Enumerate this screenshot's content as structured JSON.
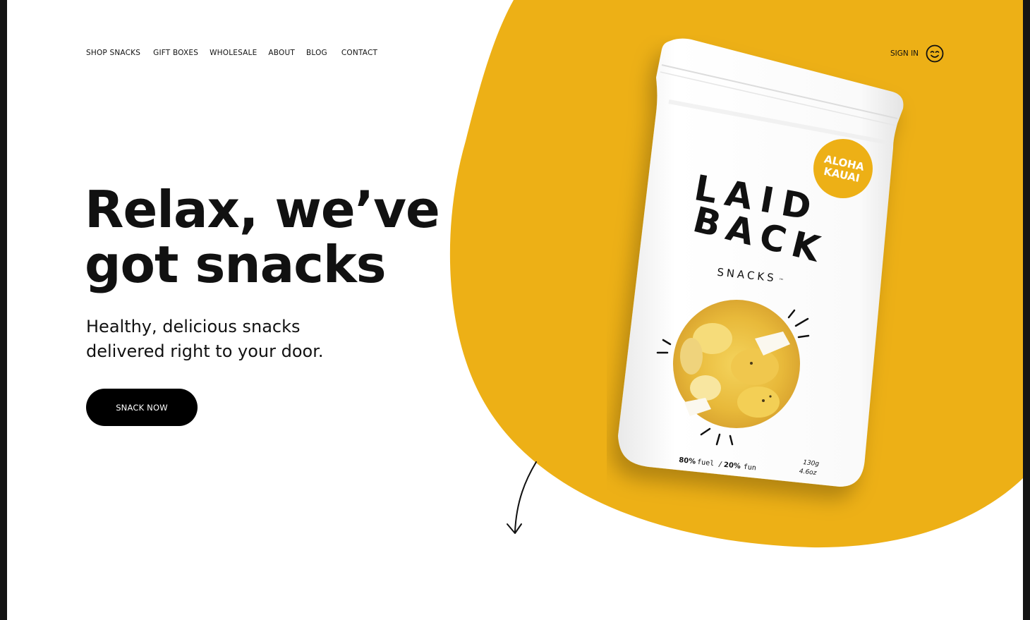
{
  "nav": {
    "items": [
      {
        "label": "SHOP SNACKS"
      },
      {
        "label": "GIFT BOXES"
      },
      {
        "label": "WHOLESALE"
      },
      {
        "label": "ABOUT"
      },
      {
        "label": "BLOG"
      },
      {
        "label": "CONTACT"
      }
    ],
    "signin_label": "SIGN IN",
    "account_icon": "smiling-face-icon"
  },
  "hero": {
    "headline_line1": "Relax, we’ve",
    "headline_line2": "got snacks",
    "subhead_line1": "Healthy, delicious snacks",
    "subhead_line2": "delivered right to your door.",
    "cta_label": "SNACK NOW",
    "scroll_icon": "curved-arrow-down-icon"
  },
  "product": {
    "brand_line1": "LAID",
    "brand_line2": "BACK",
    "brand_sub": "SNACKS",
    "trademark": "™",
    "flavor_line1": "ALOHA",
    "flavor_line2": "KAUAI",
    "tagline_a": "80%",
    "tagline_b": "fuel /",
    "tagline_c": "20%",
    "tagline_d": "fun",
    "weight_g": "130g",
    "weight_oz": "4.6oz"
  },
  "colors": {
    "accent": "#EDB016",
    "text": "#111111",
    "button_bg": "#000000",
    "background": "#FFFFFF"
  }
}
